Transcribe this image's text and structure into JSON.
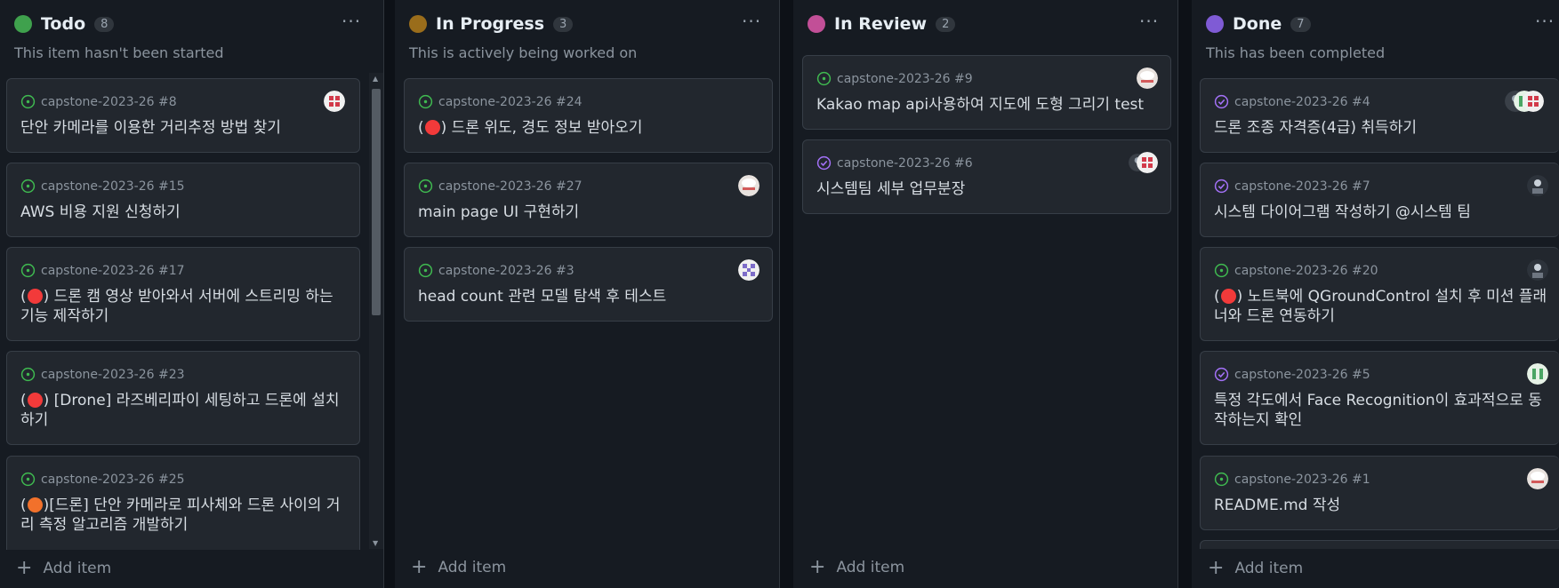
{
  "colors": {
    "todo": "#3fa14d",
    "in_progress": "#9a6d1b",
    "in_review": "#c24f97",
    "done": "#7f5bd5"
  },
  "add_item_label": "Add item",
  "columns": [
    {
      "title": "Todo",
      "count": "8",
      "description": "This item hasn't been started",
      "cards": [
        {
          "ref": "capstone-2023-26 #8",
          "title": "단안 카메라를 이용한 거리추정 방법 찾기"
        },
        {
          "ref": "capstone-2023-26 #15",
          "title": "AWS 비용 지원 신청하기"
        },
        {
          "ref": "capstone-2023-26 #17",
          "prefix": "(",
          "title": ") 드론 캠 영상 받아와서 서버에 스트리밍 하는 기능 제작하기"
        },
        {
          "ref": "capstone-2023-26 #23",
          "prefix": "(",
          "title": ") [Drone] 라즈베리파이 세팅하고 드론에 설치하기"
        },
        {
          "ref": "capstone-2023-26 #25",
          "prefix": "(",
          "title": ")[드론] 단안 카메라로 피사체와 드론 사이의 거리 측정 알고리즘 개발하기"
        }
      ]
    },
    {
      "title": "In Progress",
      "count": "3",
      "description": "This is actively being worked on",
      "cards": [
        {
          "ref": "capstone-2023-26 #24",
          "prefix": "(",
          "title": ") 드론 위도, 경도 정보 받아오기"
        },
        {
          "ref": "capstone-2023-26 #27",
          "title": "main page UI 구현하기"
        },
        {
          "ref": "capstone-2023-26 #3",
          "title": "head count 관련 모델 탐색 후 테스트"
        }
      ]
    },
    {
      "title": "In Review",
      "count": "2",
      "description": "",
      "cards": [
        {
          "ref": "capstone-2023-26 #9",
          "title": "Kakao map api사용하여 지도에 도형 그리기 test"
        },
        {
          "ref": "capstone-2023-26 #6",
          "title": "시스템팀 세부 업무분장"
        }
      ]
    },
    {
      "title": "Done",
      "count": "7",
      "description": "This has been completed",
      "cards": [
        {
          "ref": "capstone-2023-26 #4",
          "title": "드론 조종 자격증(4급) 취득하기"
        },
        {
          "ref": "capstone-2023-26 #7",
          "title": "시스템 다이어그램 작성하기 @시스템 팀"
        },
        {
          "ref": "capstone-2023-26 #20",
          "prefix": "(",
          "title": ") 노트북에 QGroundControl 설치 후 미션 플래너와 드론 연동하기"
        },
        {
          "ref": "capstone-2023-26 #5",
          "title": "특정 각도에서 Face Recognition이 효과적으로 동작하는지 확인"
        },
        {
          "ref": "capstone-2023-26 #1",
          "title": "README.md 작성"
        }
      ]
    }
  ]
}
